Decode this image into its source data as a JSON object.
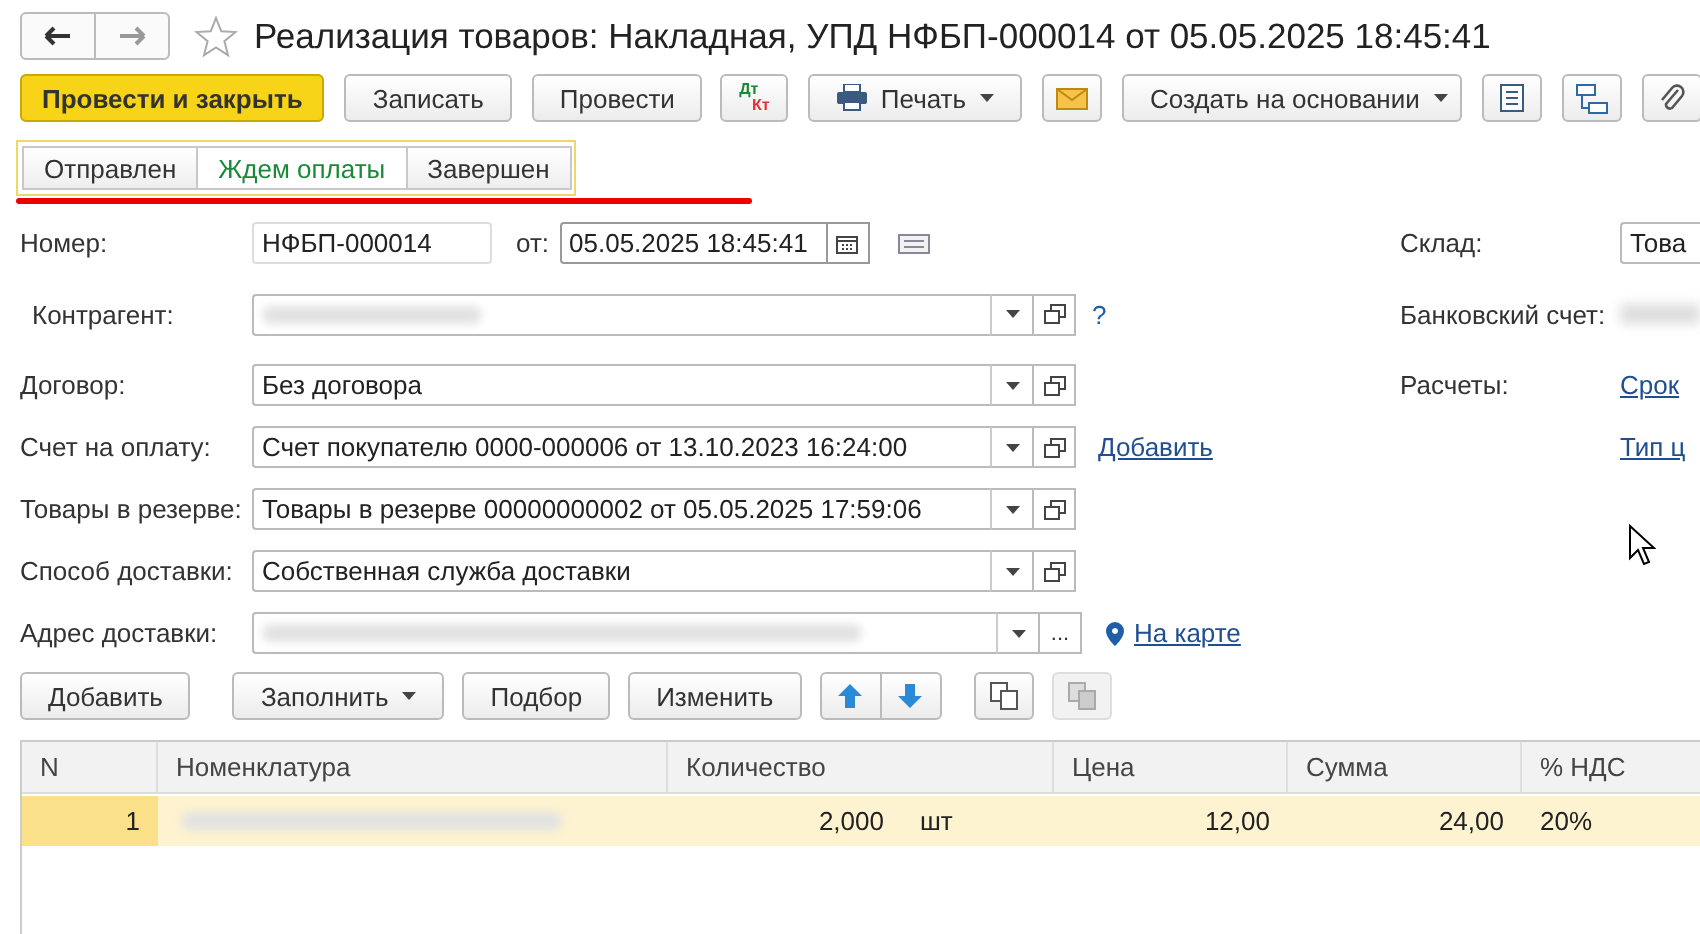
{
  "window": {
    "title": "Реализация товаров: Накладная, УПД НФБП-000014 от 05.05.2025 18:45:41"
  },
  "toolbar": [
    {
      "kind": "primary",
      "label": "Провести и закрыть"
    },
    {
      "kind": "plain",
      "label": "Записать"
    },
    {
      "kind": "plain",
      "label": "Провести"
    },
    {
      "kind": "dtkt",
      "top": "Дт",
      "bottom": "Кт"
    },
    {
      "kind": "print",
      "label": "Печать",
      "dropdown": true
    },
    {
      "kind": "mail"
    },
    {
      "kind": "plain",
      "label": "Создать на основании",
      "dropdown": true
    },
    {
      "kind": "list"
    },
    {
      "kind": "structure"
    },
    {
      "kind": "clip"
    }
  ],
  "status_tabs": [
    {
      "label": "Отправлен",
      "selected": false
    },
    {
      "label": "Ждем оплаты",
      "selected": true
    },
    {
      "label": "Завершен",
      "selected": false
    }
  ],
  "form_left": [
    {
      "kind": "number",
      "label": "Номер:",
      "value": "НФБП-000014",
      "date_label": "от:",
      "date_value": "05.05.2025 18:45:41"
    },
    {
      "kind": "select",
      "label": "Контрагент:",
      "blurred": true,
      "open_button": true,
      "help": "?"
    },
    {
      "kind": "select",
      "label": "Договор:",
      "value": "Без договора",
      "open_button": true
    },
    {
      "kind": "select",
      "label": "Счет на оплату:",
      "value": "Счет покупателю 0000-000006 от 13.10.2023 16:24:00",
      "open_button": true,
      "link": "Добавить"
    },
    {
      "kind": "select",
      "label": "Товары в резерве:",
      "value": "Товары в резерве 00000000002 от 05.05.2025 17:59:06",
      "open_button": true
    },
    {
      "kind": "select",
      "label": "Способ доставки:",
      "value": "Собственная служба доставки",
      "open_button": true
    },
    {
      "kind": "select",
      "label": "Адрес доставки:",
      "blurred": true,
      "more": "...",
      "map_link": "На карте"
    }
  ],
  "form_right": [
    {
      "kind": "field",
      "label": "Склад:",
      "value": "Това"
    },
    {
      "kind": "field",
      "label": "Банковский счет:",
      "blurred": true
    },
    {
      "kind": "link",
      "label": "Расчеты:",
      "link": "Срок"
    },
    {
      "kind": "link",
      "link": "Тип ц"
    }
  ],
  "table_toolbar": [
    {
      "kind": "plain",
      "label": "Добавить"
    },
    {
      "kind": "plain",
      "label": "Заполнить",
      "dropdown": true
    },
    {
      "kind": "plain",
      "label": "Подбор"
    },
    {
      "kind": "plain",
      "label": "Изменить"
    },
    {
      "kind": "up"
    },
    {
      "kind": "down"
    },
    {
      "kind": "copy"
    },
    {
      "kind": "paste",
      "disabled": true
    }
  ],
  "table": {
    "columns": [
      "N",
      "Номенклатура",
      "Количество",
      "Цена",
      "Сумма",
      "% НДС"
    ],
    "rows": [
      {
        "n": "1",
        "name_blurred": true,
        "quantity": "2,000",
        "unit": "шт",
        "price": "12,00",
        "sum": "24,00",
        "vat": "20%",
        "selected": true
      }
    ]
  }
}
